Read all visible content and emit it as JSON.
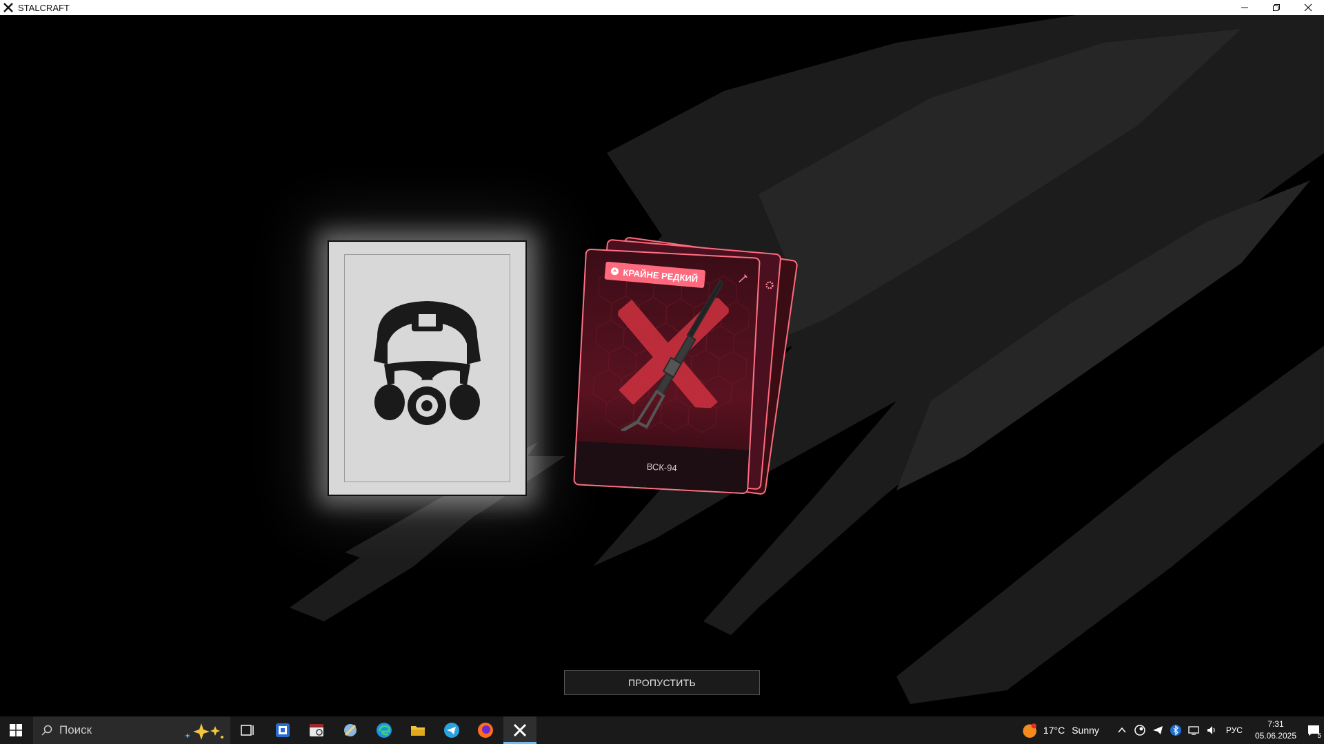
{
  "window": {
    "title": "STALCRAFT"
  },
  "reward": {
    "rarity_label": "КРАЙНЕ РЕДКИЙ",
    "item_name": "ВСК-94",
    "rarity_color": "#ff6a7e"
  },
  "skip_label": "ПРОПУСТИТЬ",
  "taskbar": {
    "search_placeholder": "Поиск",
    "pinned": [
      "task-view-icon",
      "app-icon-1",
      "calendar-app-icon",
      "settings-brush-icon",
      "edge-icon",
      "file-explorer-icon",
      "telegram-icon",
      "firefox-icon",
      "stalcraft-icon"
    ],
    "weather_temp": "17°C",
    "weather_text": "Sunny",
    "language": "РУС",
    "time": "7:31",
    "date": "05.06.2025",
    "notification_count": "5"
  }
}
